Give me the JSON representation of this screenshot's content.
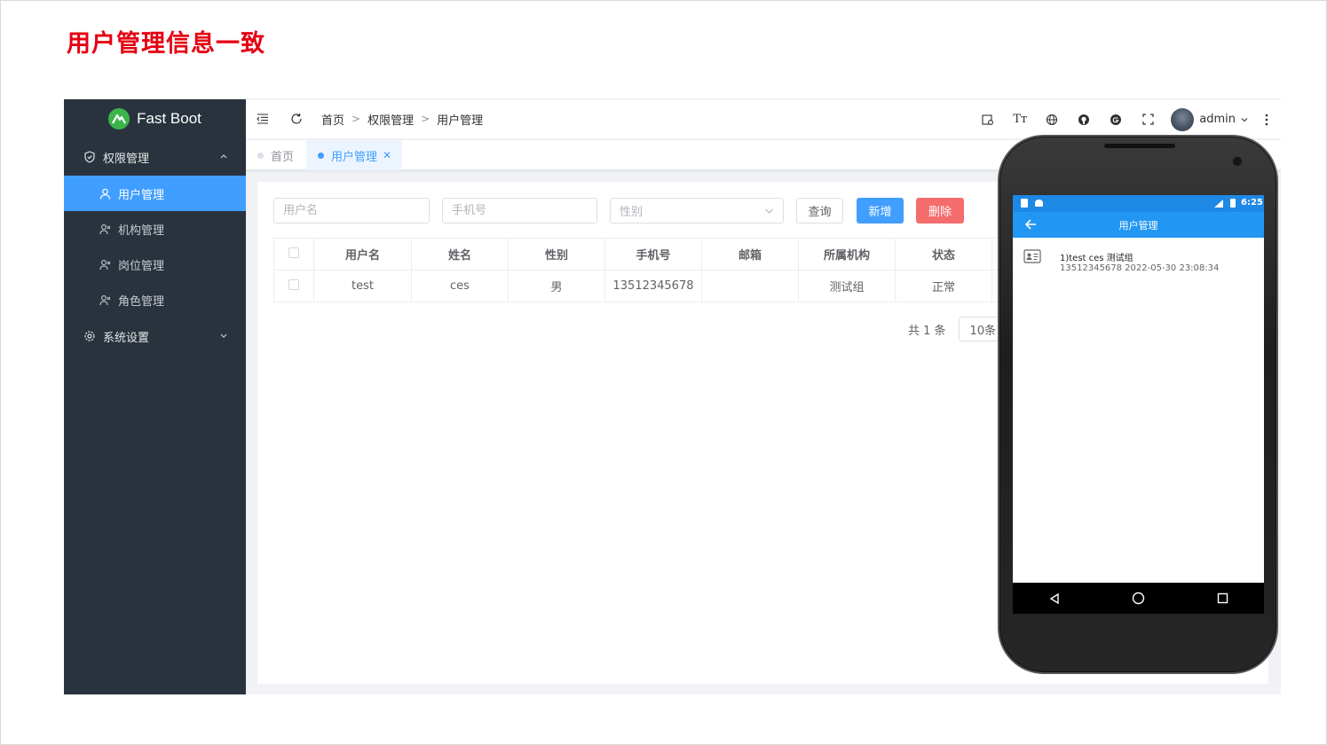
{
  "slide": {
    "title": "用户管理信息一致"
  },
  "app": {
    "logo_text": "Fast Boot",
    "sidebar": {
      "group1": "权限管理",
      "items": [
        "用户管理",
        "机构管理",
        "岗位管理",
        "角色管理"
      ],
      "group2": "系统设置"
    },
    "breadcrumb": [
      "首页",
      "权限管理",
      "用户管理"
    ],
    "user_name": "admin",
    "tags": {
      "home": "首页",
      "active": "用户管理"
    },
    "search": {
      "username_placeholder": "用户名",
      "mobile_placeholder": "手机号",
      "gender_placeholder": "性别"
    },
    "buttons": {
      "query": "查询",
      "add": "新增",
      "delete": "删除"
    },
    "table": {
      "headers": [
        "用户名",
        "姓名",
        "性别",
        "手机号",
        "邮箱",
        "所属机构",
        "状态"
      ],
      "rows": [
        [
          "test",
          "ces",
          "男",
          "13512345678",
          "",
          "测试组",
          "正常"
        ]
      ]
    },
    "pager": {
      "total": "共 1 条",
      "size": "10条"
    }
  },
  "phone": {
    "time": "6:25",
    "title": "用户管理",
    "item_line1": "1)test ces 测试组",
    "item_line2": "13512345678 2022-05-30 23:08:34"
  },
  "colors": {
    "accent": "#409eff",
    "danger": "#f56c6c",
    "sidebar": "#28333e",
    "title_red": "#e60012",
    "android_blue": "#2196f3"
  }
}
